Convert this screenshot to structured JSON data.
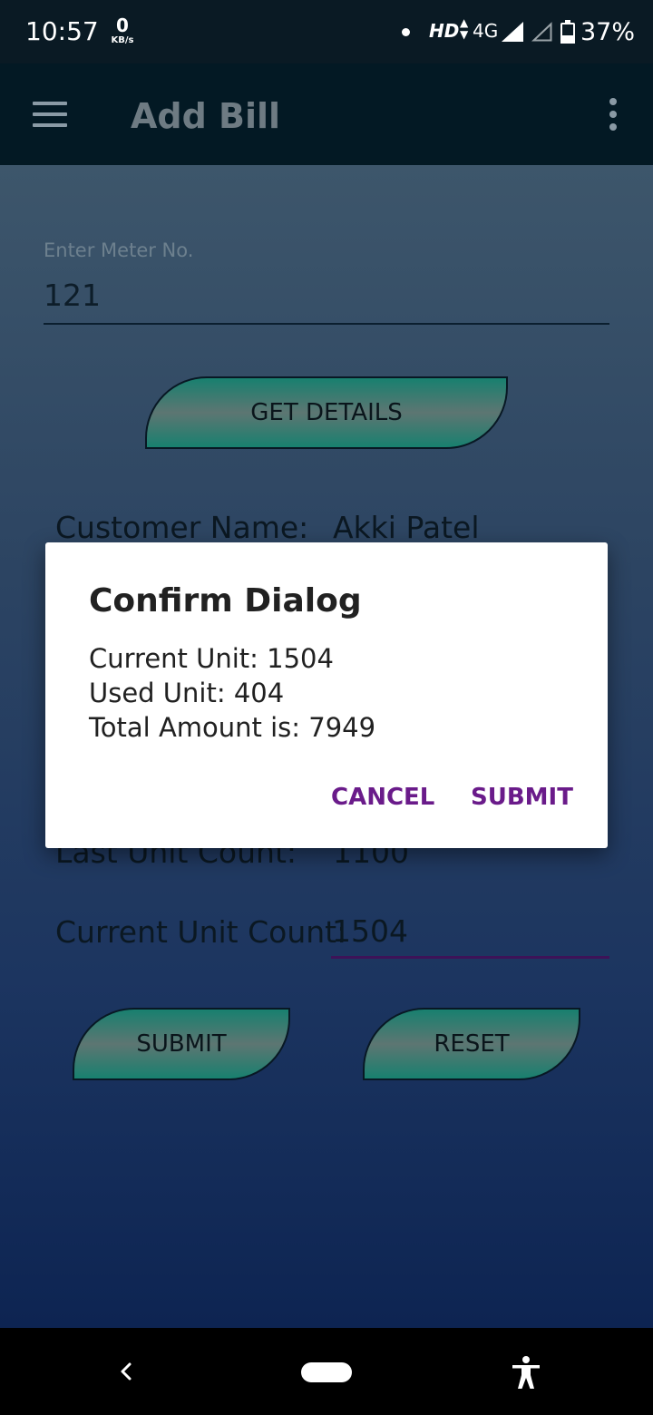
{
  "status_bar": {
    "time": "10:57",
    "data_speed_value": "0",
    "data_speed_unit": "KB/s",
    "hd": "HD",
    "network": "4G",
    "battery_percent": "37%",
    "battery_level": 0.37,
    "icons": [
      "notification-dot-icon",
      "data-arrows-icon",
      "signal-full-icon",
      "signal-empty-icon",
      "battery-icon"
    ]
  },
  "app_bar": {
    "title": "Add Bill",
    "icons": [
      "hamburger-menu-icon",
      "overflow-menu-icon"
    ]
  },
  "form": {
    "meter_label": "Enter Meter No.",
    "meter_value": "121",
    "get_details_label": "GET DETAILS",
    "customer_name_label": "Customer Name:",
    "customer_name_value": "Akki Patel",
    "last_unit_label": "Last Unit Count:",
    "last_unit_value": "1100",
    "current_unit_label": "Current Unit Count:",
    "current_unit_value": "1504",
    "submit_label": "SUBMIT",
    "reset_label": "RESET"
  },
  "dialog": {
    "title": "Confirm Dialog",
    "lines": [
      "Current Unit: 1504",
      "Used Unit: 404",
      "Total Amount is: 7949"
    ],
    "cancel_label": "CANCEL",
    "submit_label": "SUBMIT"
  },
  "nav_bar": {
    "icons": [
      "back-icon",
      "home-pill-icon",
      "accessibility-icon"
    ]
  },
  "colors": {
    "status_bar_bg": "#0a1a24",
    "app_bar_bg": "#031924",
    "button_teal": "#18806f",
    "dialog_action": "#6a1b8a",
    "input_focus_underline": "#3d1358"
  }
}
